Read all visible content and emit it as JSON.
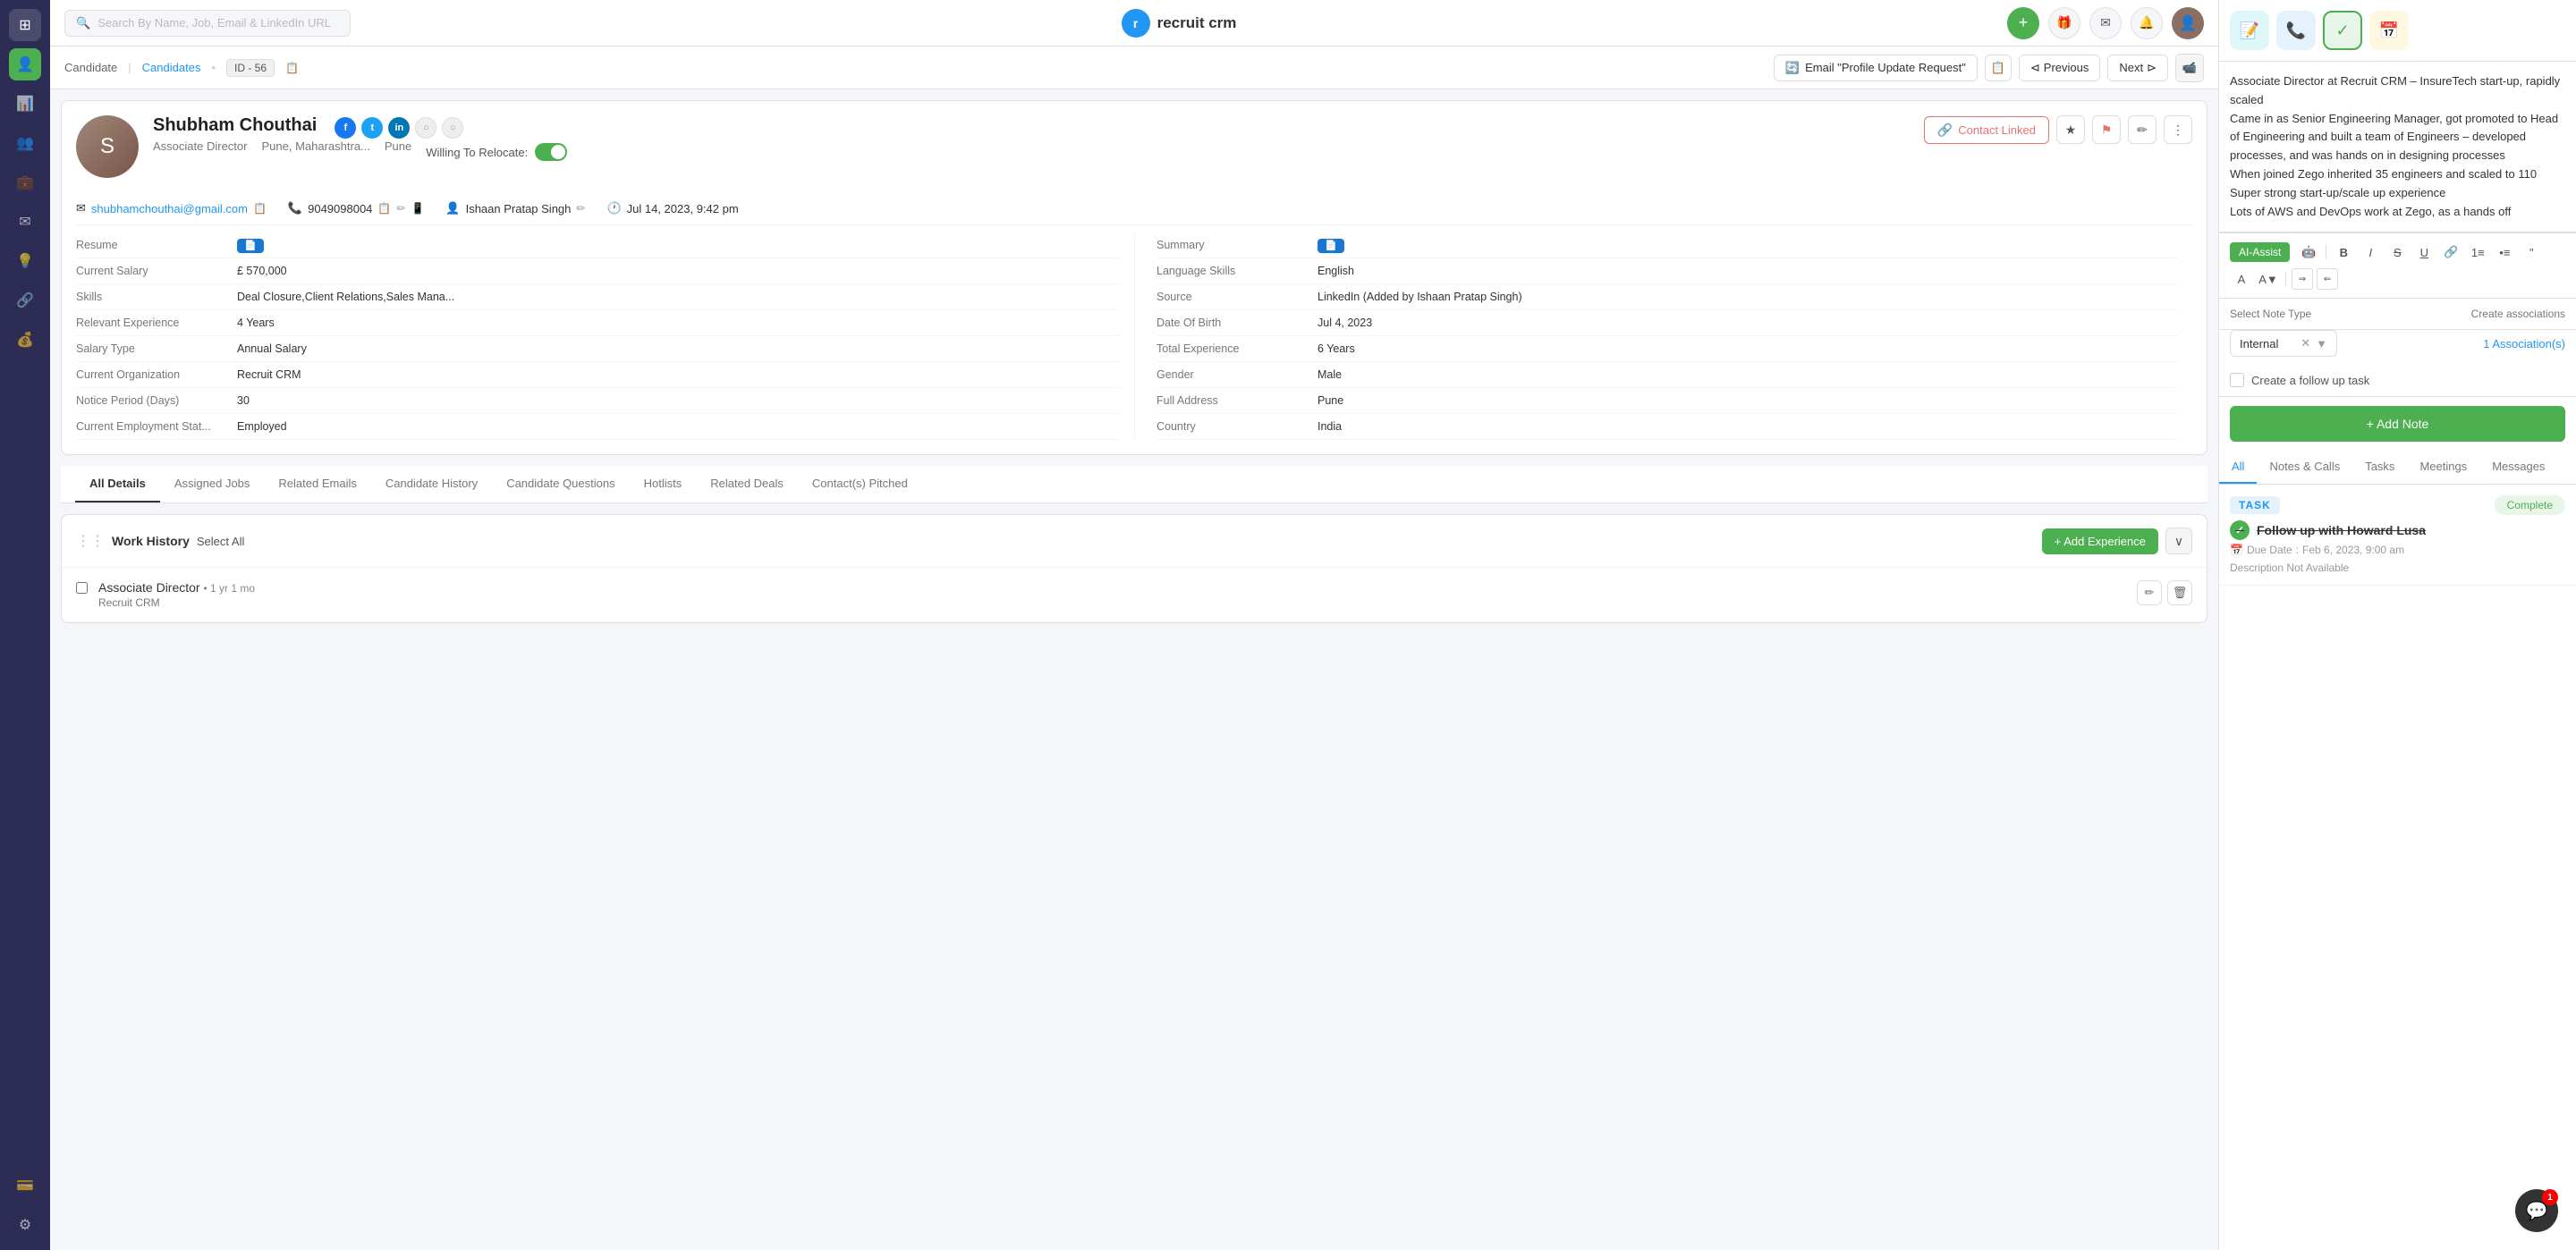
{
  "app": {
    "name": "recruit crm",
    "logo_letter": "r"
  },
  "search": {
    "placeholder": "Search By Name, Job, Email & LinkedIn URL"
  },
  "breadcrumb": {
    "part1": "Candidate",
    "sep": "|",
    "part2": "Candidates",
    "dot": "•",
    "id_label": "ID - 56"
  },
  "toolbar": {
    "email_label": "Email \"Profile Update Request\"",
    "prev_label": "Previous",
    "next_label": "Next"
  },
  "candidate": {
    "name": "Shubham Chouthai",
    "title": "Associate Director",
    "location": "Pune, Maharashtra...",
    "city": "Pune",
    "email": "shubhamchouthai@gmail.com",
    "phone": "9049098004",
    "owner": "Ishaan Pratap Singh",
    "last_updated": "Jul 14, 2023, 9:42 pm",
    "willing_to_relocate": "Willing To Relocate:",
    "contact_linked": "Contact Linked"
  },
  "details_left": [
    {
      "label": "Resume",
      "value": ""
    },
    {
      "label": "Current Salary",
      "value": "£ 570,000"
    },
    {
      "label": "Skills",
      "value": "Deal Closure,Client Relations,Sales Mana..."
    },
    {
      "label": "Relevant Experience",
      "value": "4 Years"
    },
    {
      "label": "Salary Type",
      "value": "Annual Salary"
    },
    {
      "label": "Current Organization",
      "value": "Recruit CRM"
    },
    {
      "label": "Notice Period (Days)",
      "value": "30"
    },
    {
      "label": "Current Employment Stat...",
      "value": "Employed"
    }
  ],
  "details_right": [
    {
      "label": "Summary",
      "value": ""
    },
    {
      "label": "Language Skills",
      "value": "English"
    },
    {
      "label": "Source",
      "value": "LinkedIn (Added by Ishaan Pratap Singh)"
    },
    {
      "label": "Date Of Birth",
      "value": "Jul 4, 2023"
    },
    {
      "label": "Total Experience",
      "value": "6 Years"
    },
    {
      "label": "Gender",
      "value": "Male"
    },
    {
      "label": "Full Address",
      "value": "Pune"
    },
    {
      "label": "Country",
      "value": "India"
    }
  ],
  "tabs": [
    {
      "label": "All Details",
      "active": true
    },
    {
      "label": "Assigned Jobs"
    },
    {
      "label": "Related Emails"
    },
    {
      "label": "Candidate History"
    },
    {
      "label": "Candidate Questions"
    },
    {
      "label": "Hotlists"
    },
    {
      "label": "Related Deals"
    },
    {
      "label": "Contact(s) Pitched"
    }
  ],
  "work_history": {
    "title": "Work History",
    "select_all": "Select All",
    "add_btn": "+ Add Experience",
    "items": [
      {
        "title": "Associate Director",
        "duration": "• 1 yr 1 mo",
        "company": "Recruit CRM"
      }
    ]
  },
  "right_panel": {
    "note_text_lines": [
      "Associate Director at Recruit CRM – InsureTech start-up, rapidly scaled",
      "Came in as Senior Engineering Manager, got promoted to Head of Engineering and built a team of Engineers – developed processes, and was hands on in designing processes",
      "When joined Zego inherited 35 engineers and scaled to 110",
      "Super strong start-up/scale up experience",
      "Lots of AWS and DevOps work at Zego, as a hands off"
    ],
    "note_type_label": "Select Note Type",
    "note_type_value": "Internal",
    "create_association_label": "Create associations",
    "association_value": "1 Association(s)",
    "followup_label": "Create a follow up task",
    "add_note_label": "+ Add Note",
    "ai_assist_label": "AI-Assist"
  },
  "activity_tabs": [
    {
      "label": "All",
      "active": true
    },
    {
      "label": "Notes & Calls"
    },
    {
      "label": "Tasks"
    },
    {
      "label": "Meetings"
    },
    {
      "label": "Messages"
    }
  ],
  "task": {
    "badge": "TASK",
    "complete_label": "Complete",
    "title": "Follow up with Howard Lusa",
    "due_label": "Due Date",
    "due_value": "Feb 6, 2023, 9:00 am",
    "desc": "Description Not Available"
  },
  "chat": {
    "badge_count": "1"
  },
  "sidebar_icons": [
    {
      "icon": "⊞",
      "name": "dashboard"
    },
    {
      "icon": "👤",
      "name": "candidates",
      "active": true
    },
    {
      "icon": "📊",
      "name": "analytics"
    },
    {
      "icon": "👥",
      "name": "contacts"
    },
    {
      "icon": "💼",
      "name": "jobs"
    },
    {
      "icon": "✉",
      "name": "emails"
    },
    {
      "icon": "💡",
      "name": "hotlists"
    },
    {
      "icon": "🔗",
      "name": "integrations"
    },
    {
      "icon": "💰",
      "name": "deals"
    },
    {
      "icon": "➕",
      "name": "add"
    },
    {
      "icon": "💳",
      "name": "billing"
    },
    {
      "icon": "⚙",
      "name": "settings"
    }
  ]
}
